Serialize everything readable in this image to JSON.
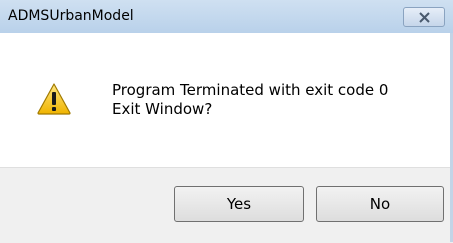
{
  "window": {
    "title": "ADMSUrbanModel"
  },
  "icons": {
    "message_icon": "warning-icon",
    "close": "close-icon"
  },
  "message": {
    "line1": "Program Terminated with exit code 0",
    "line2": "Exit Window?"
  },
  "buttons": {
    "yes_label": "Yes",
    "no_label": "No"
  },
  "colors": {
    "titlebar": "#c4d8ee",
    "footer": "#f0f0f0",
    "warning_fill": "#f7c21b",
    "warning_stroke": "#a07900"
  }
}
